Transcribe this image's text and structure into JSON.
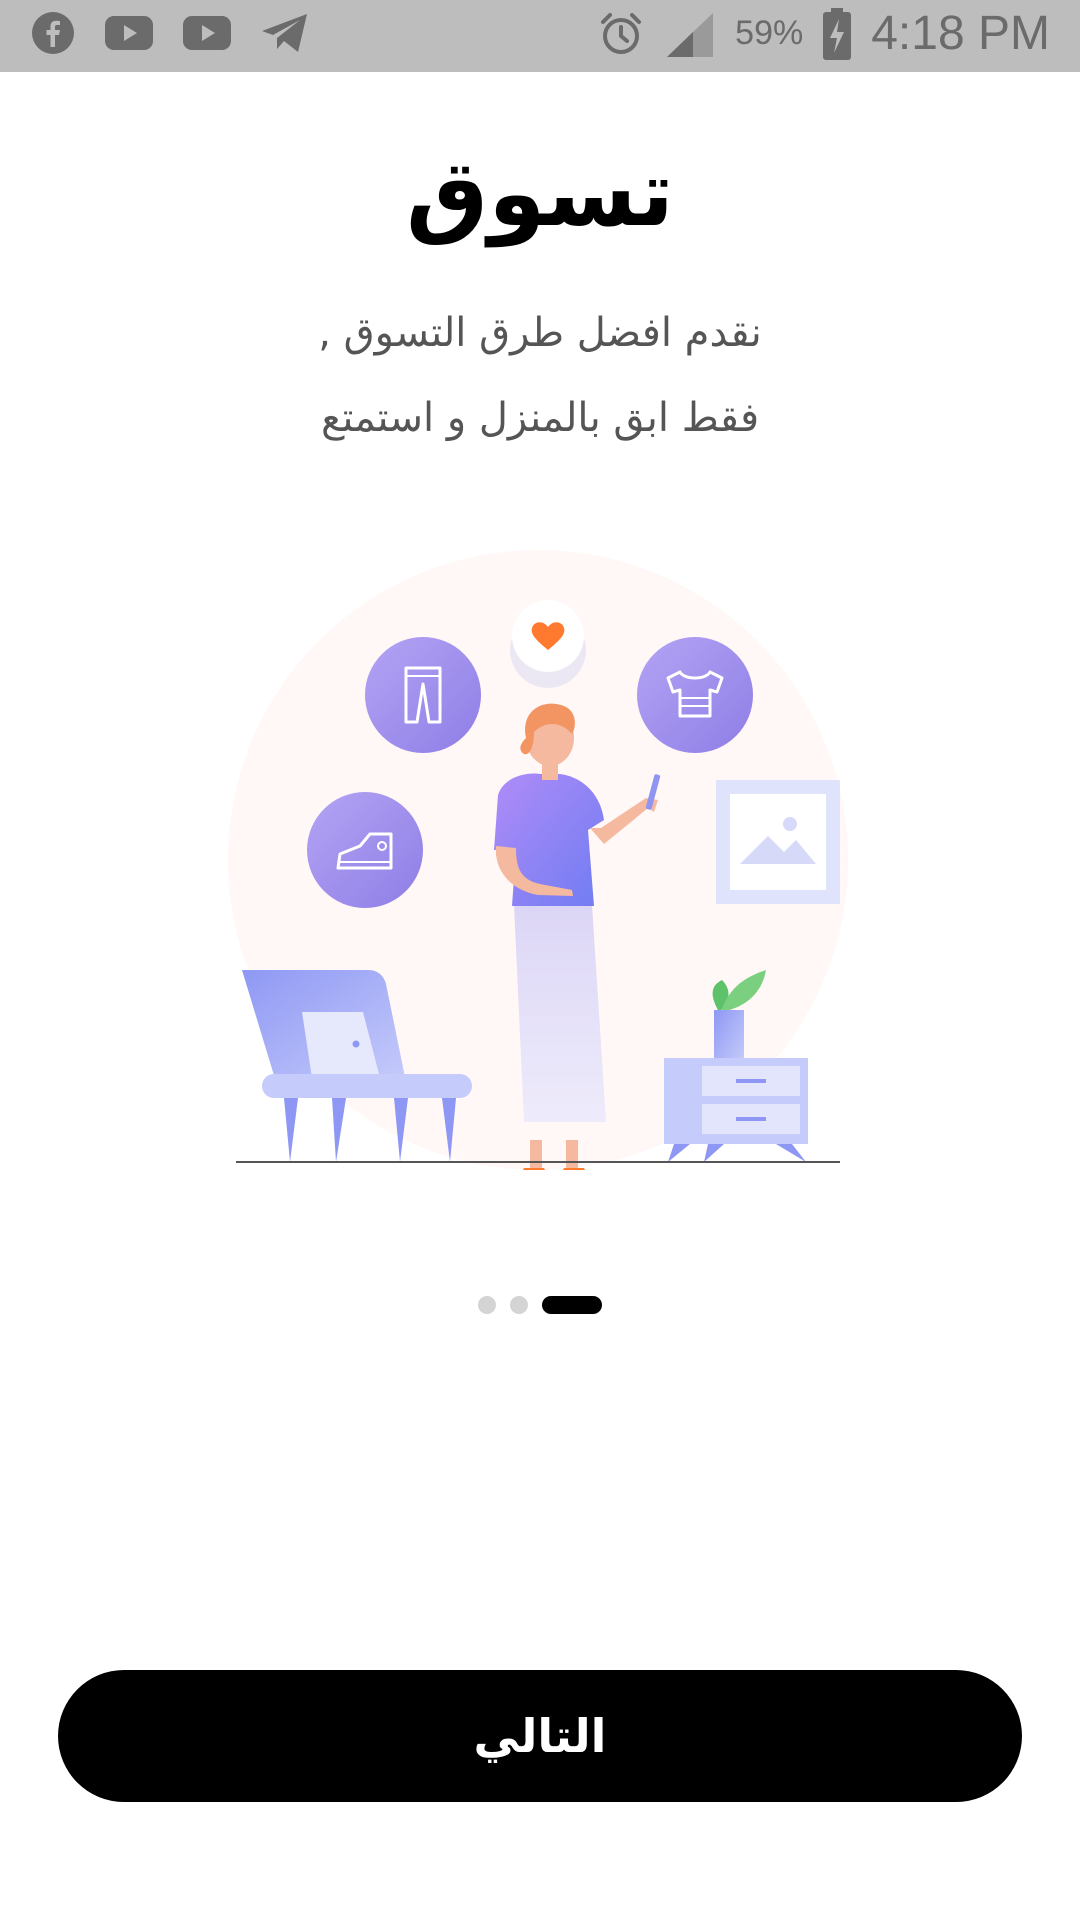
{
  "status_bar": {
    "notification_icons": [
      "facebook-icon",
      "youtube-icon",
      "youtube-icon",
      "telegram-icon"
    ],
    "alarm_icon": "alarm-icon",
    "signal_icon": "signal-icon",
    "battery_percent": "59%",
    "battery_icon": "battery-charging-icon",
    "time": "4:18 PM"
  },
  "onboarding": {
    "title": "تسوق",
    "subtitle_line1": "نقدم افضل طرق التسوق ,",
    "subtitle_line2": "فقط ابق بالمنزل و استمتع",
    "illustration": "shopping-illustration",
    "page_indicator": {
      "total": 3,
      "current": 1
    }
  },
  "actions": {
    "next_label": "التالي"
  },
  "colors": {
    "status_bar_bg": "#bdbdbd",
    "button_bg": "#000000",
    "accent_purple": "#9b8cf0",
    "heart": "#ff7a2e"
  }
}
